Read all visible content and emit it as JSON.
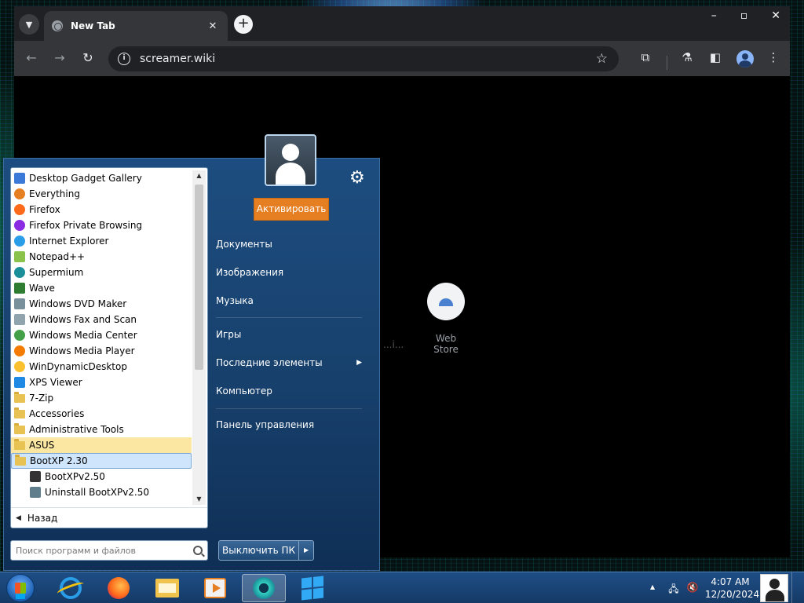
{
  "browser": {
    "tab_title": "New Tab",
    "tab_close": "✕",
    "new_tab": "+",
    "url": "screamer.wiki",
    "shortcuts": [
      {
        "label": "Web Store"
      },
      {
        "label": "...i..."
      }
    ]
  },
  "start_menu": {
    "programs": [
      {
        "label": "Desktop Gadget Gallery",
        "icon": "gadget-icon",
        "color": "#3b79d8"
      },
      {
        "label": "Everything",
        "icon": "magnifier-icon",
        "color": "#e67e22"
      },
      {
        "label": "Firefox",
        "icon": "firefox-icon",
        "color": "#ff6a1a"
      },
      {
        "label": "Firefox Private Browsing",
        "icon": "firefox-private-icon",
        "color": "#8a2be2"
      },
      {
        "label": "Internet Explorer",
        "icon": "ie-icon",
        "color": "#2a9de8"
      },
      {
        "label": "Notepad++",
        "icon": "notepad-icon",
        "color": "#8bc34a"
      },
      {
        "label": "Supermium",
        "icon": "supermium-icon",
        "color": "#1a8f9a"
      },
      {
        "label": "Wave",
        "icon": "wave-icon",
        "color": "#2e7d32"
      },
      {
        "label": "Windows DVD Maker",
        "icon": "dvd-icon",
        "color": "#78909c"
      },
      {
        "label": "Windows Fax and Scan",
        "icon": "fax-icon",
        "color": "#90a4ae"
      },
      {
        "label": "Windows Media Center",
        "icon": "media-center-icon",
        "color": "#43a047"
      },
      {
        "label": "Windows Media Player",
        "icon": "media-player-icon",
        "color": "#f57c00"
      },
      {
        "label": "WinDynamicDesktop",
        "icon": "dynamic-desktop-icon",
        "color": "#fbc02d"
      },
      {
        "label": "XPS Viewer",
        "icon": "xps-icon",
        "color": "#1e88e5"
      },
      {
        "label": "7-Zip",
        "icon": "folder-icon",
        "folder": true
      },
      {
        "label": "Accessories",
        "icon": "folder-icon",
        "folder": true
      },
      {
        "label": "Administrative Tools",
        "icon": "folder-icon",
        "folder": true
      },
      {
        "label": "ASUS",
        "icon": "folder-icon",
        "folder": true,
        "highlight": "yellow"
      },
      {
        "label": "BootXP 2.30",
        "icon": "folder-icon",
        "folder": true,
        "highlight": "blue"
      },
      {
        "label": "BootXPv2.50",
        "icon": "bootxp-icon",
        "sub": true,
        "color": "#333333"
      },
      {
        "label": "Uninstall BootXPv2.50",
        "icon": "uninstall-icon",
        "sub": true,
        "color": "#607d8b"
      }
    ],
    "back_label": "Назад",
    "search_placeholder": "Поиск программ и файлов",
    "activate_label": "Активировать",
    "right_items": [
      {
        "label": "Документы"
      },
      {
        "label": "Изображения"
      },
      {
        "label": "Музыка"
      },
      {
        "label": "Игры"
      },
      {
        "label": "Последние элементы",
        "submenu": true
      },
      {
        "label": "Компьютер"
      },
      {
        "label": "Панель управления"
      }
    ],
    "shutdown_label": "Выключить ПК"
  },
  "taskbar": {
    "time": "4:07 AM",
    "date": "12/20/2024"
  },
  "colors": {
    "accent_orange": "#e67e22",
    "menu_blue": "#1d4d80",
    "taskbar_blue": "#1e4e86"
  }
}
